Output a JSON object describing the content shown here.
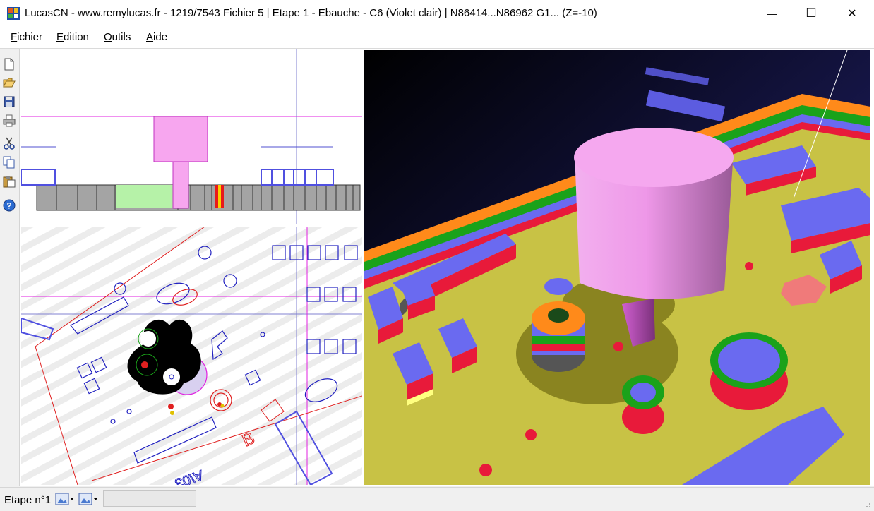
{
  "window": {
    "title": "LucasCN - www.remylucas.fr - 1219/7543  Fichier 5 | Etape 1 - Ebauche - C6 (Violet clair) |  N86414...N86962 G1... (Z=-10)",
    "controls": {
      "minimize": "—",
      "maximize": "☐",
      "close": "✕"
    }
  },
  "menu": [
    {
      "accel": "F",
      "rest": "ichier"
    },
    {
      "accel": "E",
      "rest": "dition"
    },
    {
      "accel": "O",
      "rest": "utils"
    },
    {
      "accel": "A",
      "rest": "ide"
    }
  ],
  "toolbar": {
    "buttons": [
      "new-file-icon",
      "open-folder-icon",
      "save-icon",
      "print-icon",
      "cut-icon",
      "copy-icon",
      "paste-icon",
      "help-icon"
    ]
  },
  "views": {
    "top_view": "section-view",
    "bottom_view": "plan-view",
    "main_view": "3d-simulation-view",
    "plan_texts": [
      "B",
      "A\\03"
    ]
  },
  "status": {
    "step_label": "Etape n°1",
    "field_value": ""
  },
  "colors": {
    "tool": "#f7a6ef",
    "board": "#c8c245",
    "magenta_line": "#e020e0",
    "blue_line": "#3232e0",
    "red_line": "#e02020",
    "layer_orange": "#ff8a1a",
    "layer_green": "#1aa21a",
    "layer_blue": "#6a6af0",
    "layer_red": "#e81a3a",
    "layer_yellow": "#ffff80"
  }
}
